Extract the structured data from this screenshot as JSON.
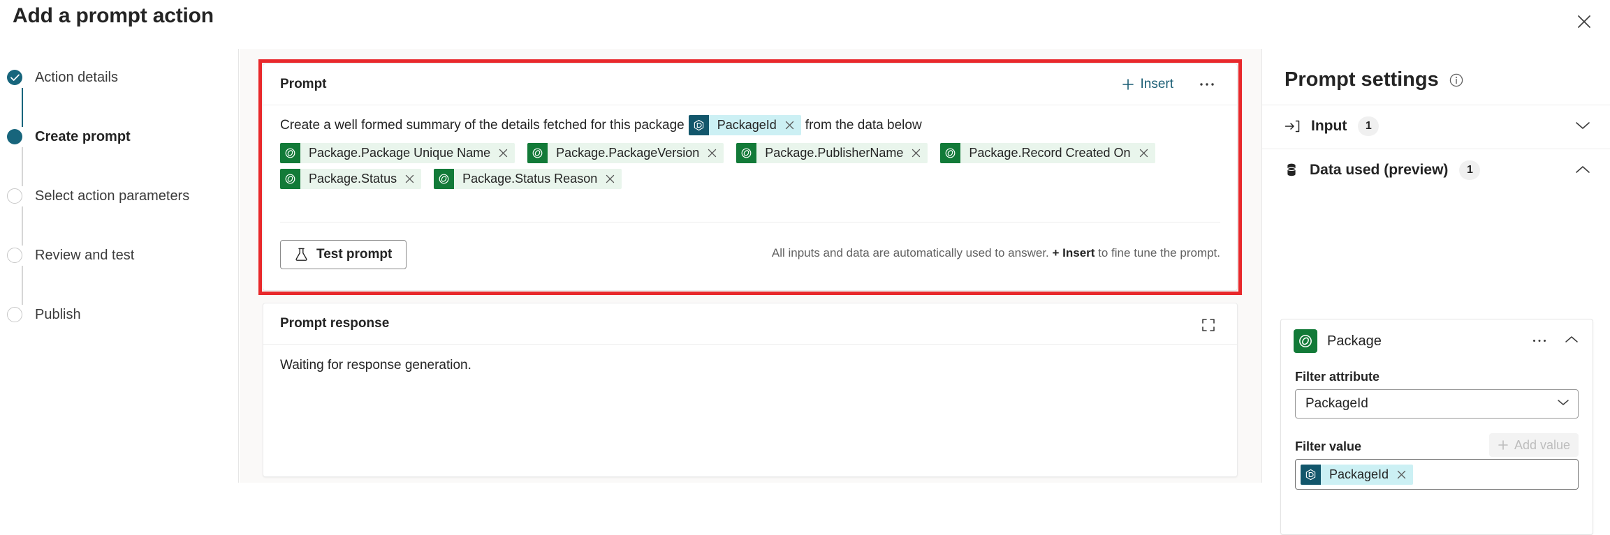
{
  "window": {
    "title": "Add a prompt action",
    "close_icon": "close-icon"
  },
  "wizard": {
    "steps": [
      {
        "label": "Action details",
        "state": "done"
      },
      {
        "label": "Create prompt",
        "state": "current"
      },
      {
        "label": "Select action parameters",
        "state": "todo"
      },
      {
        "label": "Review and test",
        "state": "todo"
      },
      {
        "label": "Publish",
        "state": "todo"
      }
    ]
  },
  "prompt_card": {
    "title": "Prompt",
    "insert_label": "Insert",
    "insert_icon": "plus-icon",
    "more_icon": "ellipsis-icon",
    "text_before": "Create a well formed summary of the details fetched for this package",
    "text_after": "from the data below",
    "inline_token": {
      "label": "PackageId",
      "type": "blue",
      "icon": "connector-icon",
      "remove_icon": "close-icon"
    },
    "tokens_row1": [
      {
        "label": "Package.Package Unique Name",
        "type": "green",
        "icon": "table-icon",
        "remove_icon": "close-icon"
      },
      {
        "label": "Package.PackageVersion",
        "type": "green",
        "icon": "table-icon",
        "remove_icon": "close-icon"
      },
      {
        "label": "Package.PublisherName",
        "type": "green",
        "icon": "table-icon",
        "remove_icon": "close-icon"
      },
      {
        "label": "Package.Record Created On",
        "type": "green",
        "icon": "table-icon",
        "remove_icon": "close-icon"
      }
    ],
    "tokens_row2": [
      {
        "label": "Package.Status",
        "type": "green",
        "icon": "table-icon",
        "remove_icon": "close-icon"
      },
      {
        "label": "Package.Status Reason",
        "type": "green",
        "icon": "table-icon",
        "remove_icon": "close-icon"
      }
    ],
    "test_button": {
      "label": "Test prompt",
      "icon": "flask-icon"
    },
    "helper_prefix": "All inputs and data are automatically used to answer. ",
    "helper_bold": "+ Insert",
    "helper_suffix": " to fine tune the prompt."
  },
  "response_card": {
    "title": "Prompt response",
    "expand_icon": "expand-icon",
    "body": "Waiting for response generation."
  },
  "settings": {
    "title": "Prompt settings",
    "info_icon": "info-icon",
    "sections": [
      {
        "label": "Input",
        "badge": "1",
        "icon": "input-arrow-icon",
        "chevron": "chevron-down-icon"
      },
      {
        "label": "Data used (preview)",
        "badge": "1",
        "icon": "database-icon",
        "chevron": "chevron-up-icon"
      }
    ],
    "data_card": {
      "name": "Package",
      "icon": "table-icon",
      "more_icon": "ellipsis-icon",
      "chevron": "chevron-up-icon",
      "filter_attribute_label": "Filter attribute",
      "filter_attribute_value": "PackageId",
      "filter_value_label": "Filter value",
      "add_value_label": "Add value",
      "add_value_icon": "plus-icon",
      "value_token": {
        "label": "PackageId",
        "type": "blue",
        "icon": "connector-icon",
        "remove_icon": "close-icon"
      }
    }
  },
  "colors": {
    "accent": "#17657c",
    "highlight_border": "#e8282b",
    "green_token": "#127a38",
    "blue_token": "#12566b"
  }
}
